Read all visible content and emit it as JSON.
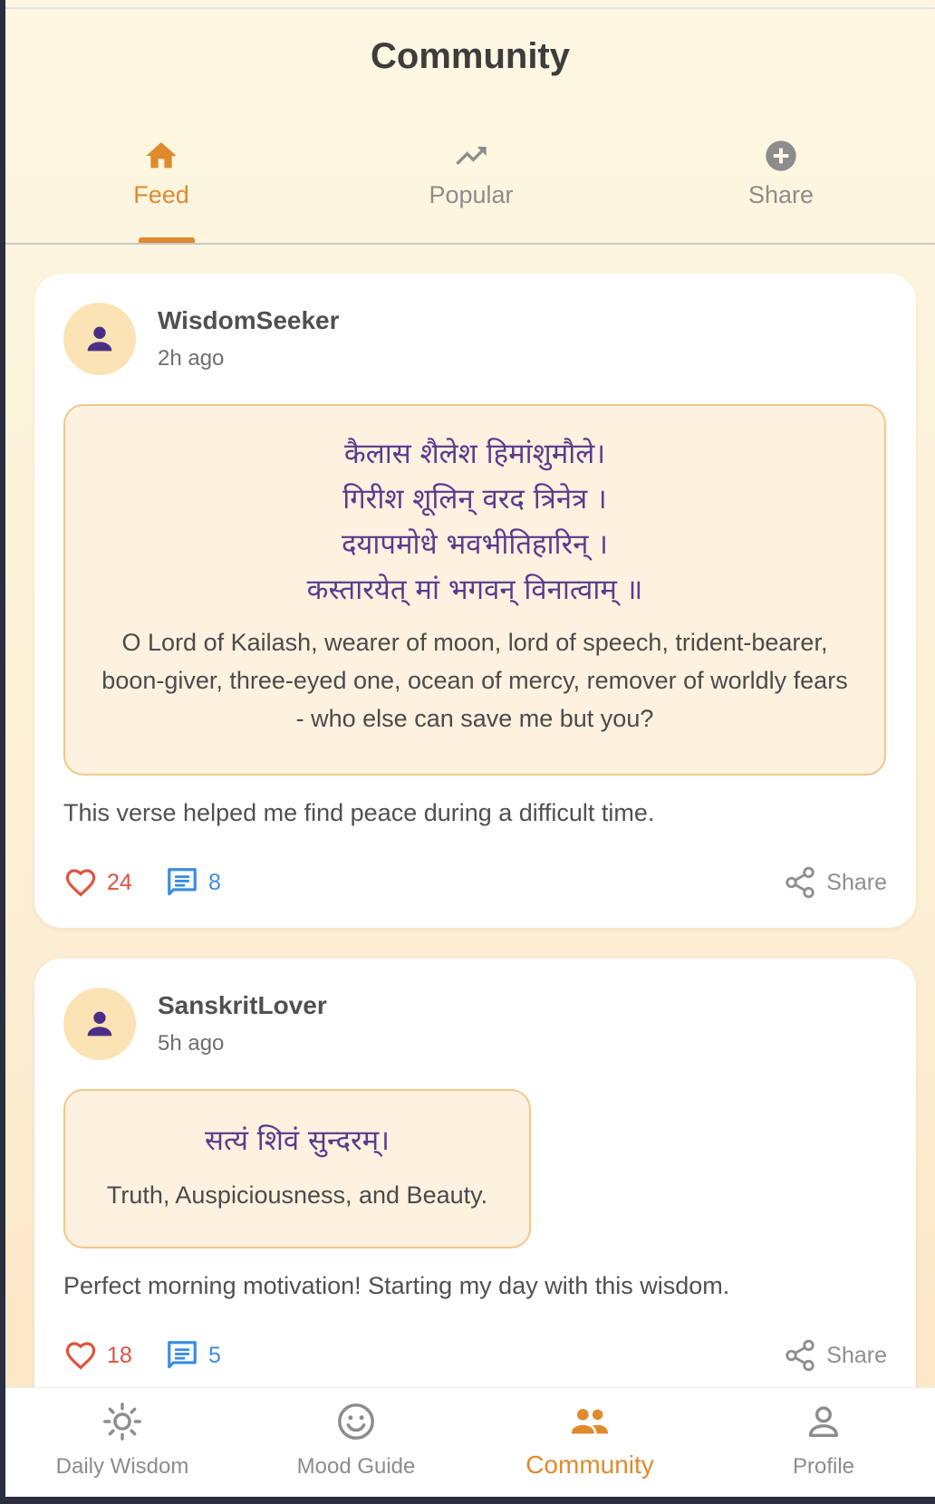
{
  "header": {
    "title": "Community"
  },
  "tabs": [
    {
      "label": "Feed",
      "icon": "home-icon",
      "active": true
    },
    {
      "label": "Popular",
      "icon": "trending-up-icon",
      "active": false
    },
    {
      "label": "Share",
      "icon": "add-circle-icon",
      "active": false
    }
  ],
  "posts": [
    {
      "username": "WisdomSeeker",
      "time": "2h ago",
      "verse_lines": [
        "कैलास शैलेश हिमांशुमौले।",
        "गिरीश शूलिन् वरद त्रिनेत्र ।",
        "दयापमोधे भवभीतिहारिन् ।",
        "कस्तारयेत् मां भगवन् विनात्वाम् ॥"
      ],
      "translation": "O Lord of Kailash, wearer of moon, lord of speech, trident-bearer, boon-giver, three-eyed one, ocean of mercy, remover of worldly fears - who else can save me but you?",
      "text": "This verse helped me find peace during a difficult time.",
      "likes": "24",
      "comments": "8",
      "share_label": "Share"
    },
    {
      "username": "SanskritLover",
      "time": "5h ago",
      "verse_lines": [
        "सत्यं शिवं सुन्दरम्।"
      ],
      "translation": "Truth, Auspiciousness, and Beauty.",
      "text": "Perfect morning motivation! Starting my day with this wisdom.",
      "likes": "18",
      "comments": "5",
      "share_label": "Share"
    }
  ],
  "bottom_nav": [
    {
      "label": "Daily Wisdom",
      "icon": "sun-icon",
      "active": false
    },
    {
      "label": "Mood Guide",
      "icon": "smiley-icon",
      "active": false
    },
    {
      "label": "Community",
      "icon": "people-icon",
      "active": true
    },
    {
      "label": "Profile",
      "icon": "person-icon",
      "active": false
    }
  ],
  "colors": {
    "accent": "#e08a2e",
    "verse_text": "#5c3a8e",
    "like": "#e0533f",
    "comment": "#3b8de0",
    "avatar_bg": "#fbe3b6"
  }
}
